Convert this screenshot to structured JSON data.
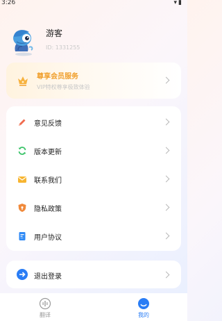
{
  "status_bar": {
    "time": "3:26",
    "icons": "▾▮"
  },
  "profile": {
    "name": "游客",
    "id_text": "ID: 1331255"
  },
  "vip": {
    "title": "尊享会员服务",
    "subtitle": "VIP特权尊享极致体验"
  },
  "menu": {
    "items": [
      {
        "label": "意见反馈",
        "icon": "feedback-icon",
        "color": "#f06a4e"
      },
      {
        "label": "版本更新",
        "icon": "refresh-icon",
        "color": "#3cc46a"
      },
      {
        "label": "联系我们",
        "icon": "mail-icon",
        "color": "#f7b531"
      },
      {
        "label": "隐私政策",
        "icon": "shield-icon",
        "color": "#f08a3c"
      },
      {
        "label": "用户协议",
        "icon": "document-icon",
        "color": "#2f8af5"
      }
    ]
  },
  "logout": {
    "label": "退出登录",
    "icon": "logout-arrow-icon",
    "color": "#2a7df5"
  },
  "tabbar": {
    "tabs": [
      {
        "label": "翻译",
        "icon": "translate-icon",
        "active": false
      },
      {
        "label": "我的",
        "icon": "profile-face-icon",
        "active": true
      }
    ],
    "active_color": "#2a7df5",
    "inactive_color": "#9a9a9a"
  }
}
